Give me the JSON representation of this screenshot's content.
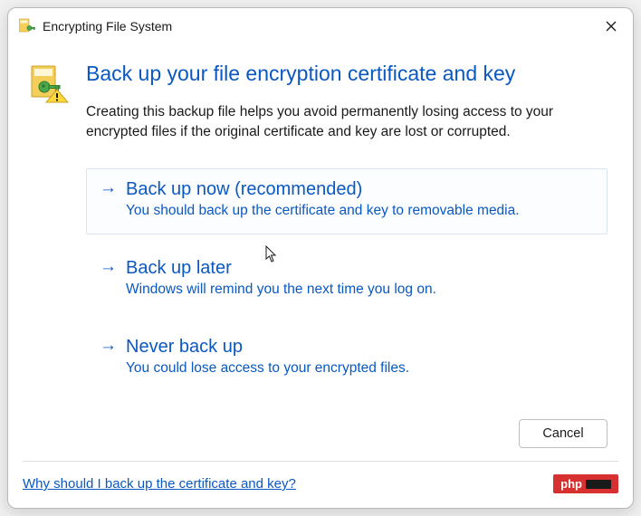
{
  "titlebar": {
    "title": "Encrypting File System"
  },
  "main": {
    "heading": "Back up your file encryption certificate and key",
    "description": "Creating this backup file helps you avoid permanently losing access to your encrypted files if the original certificate and key are lost or corrupted."
  },
  "options": [
    {
      "title": "Back up now (recommended)",
      "description": "You should back up the certificate and key to removable media."
    },
    {
      "title": "Back up later",
      "description": "Windows will remind you the next time you log on."
    },
    {
      "title": "Never back up",
      "description": "You could lose access to your encrypted files."
    }
  ],
  "buttons": {
    "cancel": "Cancel"
  },
  "footer": {
    "link": "Why should I back up the certificate and key?",
    "badge": "php"
  }
}
